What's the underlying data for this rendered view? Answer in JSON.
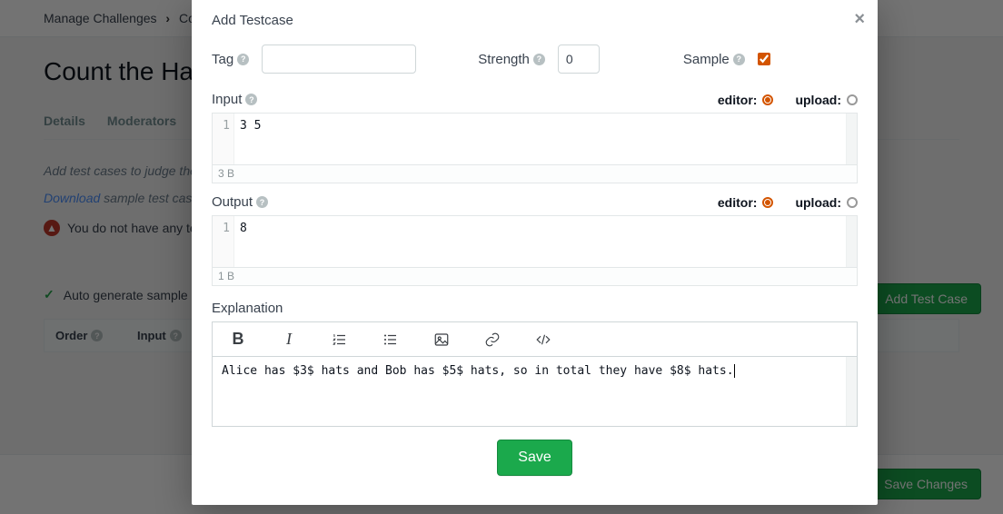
{
  "breadcrumb": {
    "root": "Manage Challenges",
    "current": "Cour"
  },
  "page_title": "Count the Ha",
  "tabs": {
    "details": "Details",
    "moderators": "Moderators"
  },
  "bg": {
    "desc": "Add test cases to judge the",
    "download_link": "Download",
    "download_rest": "sample test case",
    "warning_text": "You do not have any te",
    "autogen": "Auto generate sample ca",
    "add_test_case_btn": "Add Test Case",
    "save_changes_btn": "Save Changes"
  },
  "table_headers": {
    "order": "Order",
    "input": "Input"
  },
  "modal": {
    "title": "Add Testcase",
    "tag_label": "Tag",
    "tag_value": "",
    "strength_label": "Strength",
    "strength_value": "0",
    "sample_label": "Sample",
    "sample_checked": true,
    "input_label": "Input",
    "output_label": "Output",
    "editor_label": "editor:",
    "upload_label": "upload:",
    "input_code": "3 5",
    "input_size": "3 B",
    "output_code": "8",
    "output_size": "1 B",
    "explanation_label": "Explanation",
    "explanation_text": "Alice has $3$ hats and Bob has $5$ hats, so in total they have $8$ hats.",
    "save_btn": "Save",
    "line_one": "1"
  }
}
